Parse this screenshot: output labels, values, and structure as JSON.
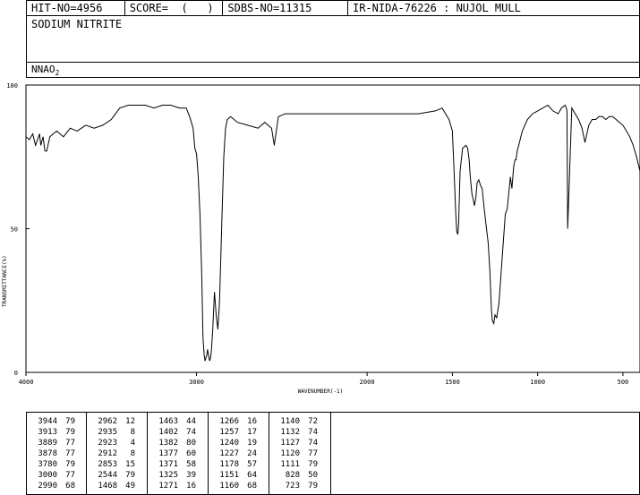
{
  "header": {
    "hit_no": "HIT-NO=4956",
    "score": "SCORE=  (   )",
    "sdbs_no": "SDBS-NO=11315",
    "ir_nida": "IR-NIDA-76226 : NUJOL MULL"
  },
  "compound_name": "SODIUM NITRITE",
  "formula": {
    "main": "NNAO",
    "sub": "2"
  },
  "chart_data": {
    "type": "line",
    "xlabel": "WAVENUMBER(-1)",
    "ylabel": "TRANSMITTANCE(%)",
    "xlim": [
      4000,
      400
    ],
    "ylim": [
      0,
      100
    ],
    "x_ticks": [
      4000,
      3000,
      2000,
      1500,
      1000,
      500
    ],
    "x_tick_labels": [
      "4000",
      "3000",
      "2000",
      "1500",
      "1000",
      "500"
    ],
    "y_ticks": [
      0,
      50,
      100
    ],
    "y_tick_labels": [
      "0",
      "50",
      "100"
    ],
    "grid": false,
    "series": [
      {
        "x": [
          4000,
          3980,
          3960,
          3944,
          3920,
          3913,
          3900,
          3889,
          3878,
          3860,
          3820,
          3780,
          3740,
          3700,
          3650,
          3600,
          3550,
          3500,
          3450,
          3400,
          3350,
          3300,
          3250,
          3200,
          3150,
          3100,
          3060,
          3040,
          3020,
          3010,
          3000,
          2990,
          2980,
          2970,
          2962,
          2955,
          2950,
          2945,
          2940,
          2935,
          2930,
          2923,
          2918,
          2912,
          2905,
          2895,
          2885,
          2875,
          2865,
          2853,
          2840,
          2830,
          2820,
          2800,
          2760,
          2700,
          2640,
          2600,
          2560,
          2544,
          2520,
          2480,
          2400,
          2300,
          2200,
          2100,
          2000,
          1900,
          1800,
          1700,
          1600,
          1560,
          1540,
          1520,
          1500,
          1490,
          1480,
          1474,
          1468,
          1463,
          1455,
          1440,
          1420,
          1410,
          1402,
          1395,
          1385,
          1377,
          1371,
          1362,
          1355,
          1345,
          1335,
          1325,
          1315,
          1300,
          1290,
          1280,
          1271,
          1266,
          1257,
          1250,
          1240,
          1227,
          1210,
          1190,
          1178,
          1170,
          1160,
          1151,
          1140,
          1132,
          1127,
          1120,
          1111,
          1090,
          1060,
          1030,
          1000,
          970,
          940,
          910,
          880,
          860,
          840,
          832,
          828,
          824,
          800,
          780,
          760,
          740,
          723,
          700,
          680,
          660,
          640,
          620,
          600,
          580,
          560,
          540,
          520,
          500,
          480,
          460,
          440,
          420,
          400
        ],
        "y": [
          82,
          81,
          83,
          79,
          83,
          79,
          82,
          77,
          77,
          82,
          84,
          82,
          85,
          84,
          86,
          85,
          86,
          88,
          92,
          93,
          93,
          93,
          92,
          93,
          93,
          92,
          92,
          89,
          85,
          78,
          76,
          68,
          55,
          35,
          12,
          6,
          4,
          5,
          6,
          8,
          6,
          4,
          5,
          8,
          15,
          28,
          20,
          15,
          25,
          50,
          75,
          85,
          88,
          89,
          87,
          86,
          85,
          87,
          85,
          79,
          89,
          90,
          90,
          90,
          90,
          90,
          90,
          90,
          90,
          90,
          91,
          92,
          90,
          88,
          84,
          70,
          55,
          49,
          48,
          52,
          70,
          78,
          79,
          78,
          74,
          68,
          62,
          60,
          58,
          61,
          66,
          67,
          65,
          64,
          58,
          50,
          45,
          35,
          22,
          18,
          17,
          20,
          19,
          24,
          38,
          55,
          57,
          62,
          68,
          64,
          72,
          74,
          74,
          77,
          79,
          84,
          88,
          90,
          91,
          92,
          93,
          91,
          90,
          92,
          93,
          92,
          91,
          50,
          92,
          90,
          88,
          85,
          80,
          86,
          88,
          88,
          89,
          89,
          88,
          89,
          89,
          88,
          87,
          86,
          84,
          82,
          79,
          75,
          70
        ]
      }
    ]
  },
  "peak_table": [
    [
      [
        "3944",
        "79"
      ],
      [
        "3913",
        "79"
      ],
      [
        "3889",
        "77"
      ],
      [
        "3878",
        "77"
      ],
      [
        "3780",
        "79"
      ],
      [
        "3000",
        "77"
      ],
      [
        "2990",
        "68"
      ]
    ],
    [
      [
        "2962",
        "12"
      ],
      [
        "2935",
        "8"
      ],
      [
        "2923",
        "4"
      ],
      [
        "2912",
        "8"
      ],
      [
        "2853",
        "15"
      ],
      [
        "2544",
        "79"
      ],
      [
        "1468",
        "49"
      ]
    ],
    [
      [
        "1463",
        "44"
      ],
      [
        "1402",
        "74"
      ],
      [
        "1382",
        "80"
      ],
      [
        "1377",
        "60"
      ],
      [
        "1371",
        "58"
      ],
      [
        "1325",
        "39"
      ],
      [
        "1271",
        "16"
      ]
    ],
    [
      [
        "1266",
        "16"
      ],
      [
        "1257",
        "17"
      ],
      [
        "1240",
        "19"
      ],
      [
        "1227",
        "24"
      ],
      [
        "1178",
        "57"
      ],
      [
        "1151",
        "64"
      ],
      [
        "1160",
        "68"
      ]
    ],
    [
      [
        "1140",
        "72"
      ],
      [
        "1132",
        "74"
      ],
      [
        "1127",
        "74"
      ],
      [
        "1120",
        "77"
      ],
      [
        "1111",
        "79"
      ],
      [
        "828",
        "50"
      ],
      [
        "723",
        "79"
      ]
    ]
  ]
}
